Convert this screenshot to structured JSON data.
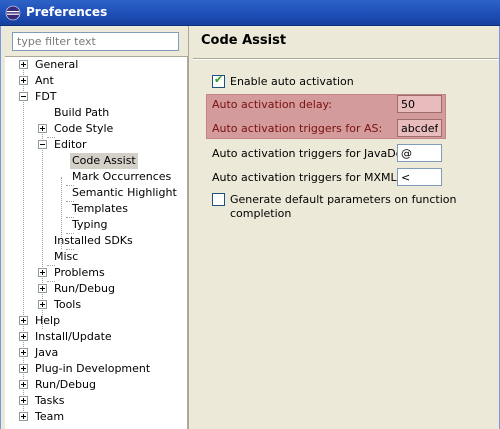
{
  "window": {
    "title": "Preferences"
  },
  "filter": {
    "placeholder": "type filter text",
    "value": ""
  },
  "tree": {
    "items": [
      {
        "label": "General",
        "expander": "plus"
      },
      {
        "label": "Ant",
        "expander": "plus"
      },
      {
        "label": "FDT",
        "expander": "minus"
      },
      {
        "label": "Build Path"
      },
      {
        "label": "Code Style",
        "expander": "plus"
      },
      {
        "label": "Editor",
        "expander": "minus"
      },
      {
        "label": "Code Assist",
        "selected": true
      },
      {
        "label": "Mark Occurrences"
      },
      {
        "label": "Semantic Highlight"
      },
      {
        "label": "Templates"
      },
      {
        "label": "Typing"
      },
      {
        "label": "Installed SDKs"
      },
      {
        "label": "Misc"
      },
      {
        "label": "Problems",
        "expander": "plus"
      },
      {
        "label": "Run/Debug",
        "expander": "plus"
      },
      {
        "label": "Tools",
        "expander": "plus"
      },
      {
        "label": "Help",
        "expander": "plus"
      },
      {
        "label": "Install/Update",
        "expander": "plus"
      },
      {
        "label": "Java",
        "expander": "plus"
      },
      {
        "label": "Plug-in Development",
        "expander": "plus"
      },
      {
        "label": "Run/Debug",
        "expander": "plus"
      },
      {
        "label": "Tasks",
        "expander": "plus"
      },
      {
        "label": "Team",
        "expander": "plus"
      }
    ]
  },
  "page": {
    "title": "Code Assist",
    "enable_auto_activation": {
      "label": "Enable auto activation",
      "checked": true
    },
    "fields": [
      {
        "label": "Auto activation delay:",
        "value": "50",
        "highlighted": true
      },
      {
        "label": "Auto activation triggers for AS:",
        "value": "abcdefghijklmnopqrstuvwxyz.",
        "highlighted": true
      },
      {
        "label": "Auto activation triggers for JavaDoc:",
        "value": "@",
        "highlighted": false
      },
      {
        "label": "Auto activation triggers for MXML:",
        "value": "<",
        "highlighted": false
      }
    ],
    "generate_defaults": {
      "label": "Generate default parameters on function completion",
      "checked": false
    }
  },
  "colors": {
    "titlebar": "#2058c0",
    "highlight": "#d39b9b",
    "selection": "#d4d0c8"
  },
  "icons": {
    "app": "eclipse-icon",
    "check": "check-icon"
  }
}
